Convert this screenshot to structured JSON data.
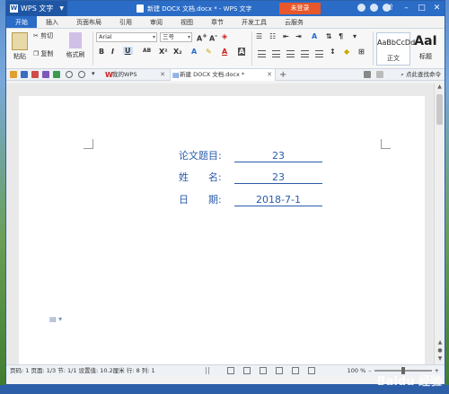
{
  "app": {
    "name": "WPS 文字",
    "document_title": "新建 DOCX 文档.docx * - WPS 文字",
    "login_label": "未登录"
  },
  "ribbon_tabs": [
    "开始",
    "插入",
    "页面布局",
    "引用",
    "审阅",
    "视图",
    "章节",
    "开发工具",
    "云服务"
  ],
  "active_tab": "开始",
  "clipboard": {
    "paste": "粘贴",
    "cut": "剪切",
    "copy": "复制",
    "format_painter": "格式刷"
  },
  "font": {
    "family": "Arial",
    "size": "三号"
  },
  "styles": {
    "normal_sample": "AaBbCcDd",
    "normal_label": "正文",
    "heading_sample": "AaI",
    "heading_label": "标题"
  },
  "doc_tabs": [
    {
      "label": "我的WPS"
    },
    {
      "label": "新建 DOCX 文档.docx *"
    }
  ],
  "command_search": "点此查找命令",
  "document": {
    "rows": [
      {
        "label": "论文题目:",
        "value": "23"
      },
      {
        "label": "姓　　名:",
        "value": "23"
      },
      {
        "label": "日　　期:",
        "value": "2018-7-1"
      }
    ]
  },
  "status": {
    "text": "页码: 1  页面: 1/3  节: 1/1  设置值: 10.2厘米  行: 8  列: 1",
    "zoom": "100 %"
  },
  "watermark": "Baidu 经验",
  "colors": {
    "titlebar": "#2a6cc6",
    "accent_login": "#e8572a",
    "document_text": "#2a5caa"
  }
}
